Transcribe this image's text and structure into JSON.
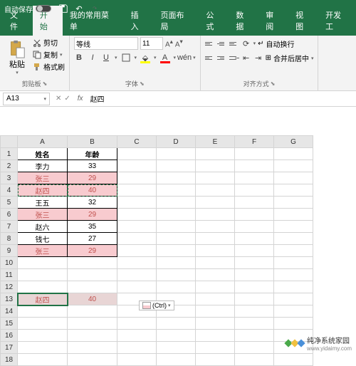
{
  "titlebar": {
    "autosave": "自动保存"
  },
  "tabs": [
    "文件",
    "开始",
    "我的常用菜单",
    "插入",
    "页面布局",
    "公式",
    "数据",
    "审阅",
    "视图",
    "开发工"
  ],
  "active_tab": 1,
  "clipboard": {
    "paste": "粘贴",
    "cut": "剪切",
    "copy": "复制",
    "format_painter": "格式刷",
    "group": "剪贴板"
  },
  "font": {
    "name": "等线",
    "size": "11",
    "group": "字体"
  },
  "align": {
    "wrap": "自动换行",
    "merge": "合并后居中",
    "group": "对齐方式"
  },
  "namebox": "A13",
  "formula": "赵四",
  "columns": [
    "A",
    "B",
    "C",
    "D",
    "E",
    "F",
    "G"
  ],
  "rows": 18,
  "table": {
    "headers": [
      "姓名",
      "年龄"
    ],
    "rows": [
      {
        "name": "李力",
        "age": "33",
        "hl": false
      },
      {
        "name": "张三",
        "age": "29",
        "hl": true
      },
      {
        "name": "赵四",
        "age": "40",
        "hl": true,
        "marching": true
      },
      {
        "name": "王五",
        "age": "32",
        "hl": false
      },
      {
        "name": "张三",
        "age": "29",
        "hl": true
      },
      {
        "name": "赵六",
        "age": "35",
        "hl": false
      },
      {
        "name": "钱七",
        "age": "27",
        "hl": false
      },
      {
        "name": "张三",
        "age": "29",
        "hl": true
      }
    ]
  },
  "pasted": {
    "row": 13,
    "name": "赵四",
    "age": "40"
  },
  "ctrl_tag": "(Ctrl)",
  "watermark": {
    "text": "纯净系统家园",
    "url": "www.yidaimy.com"
  }
}
